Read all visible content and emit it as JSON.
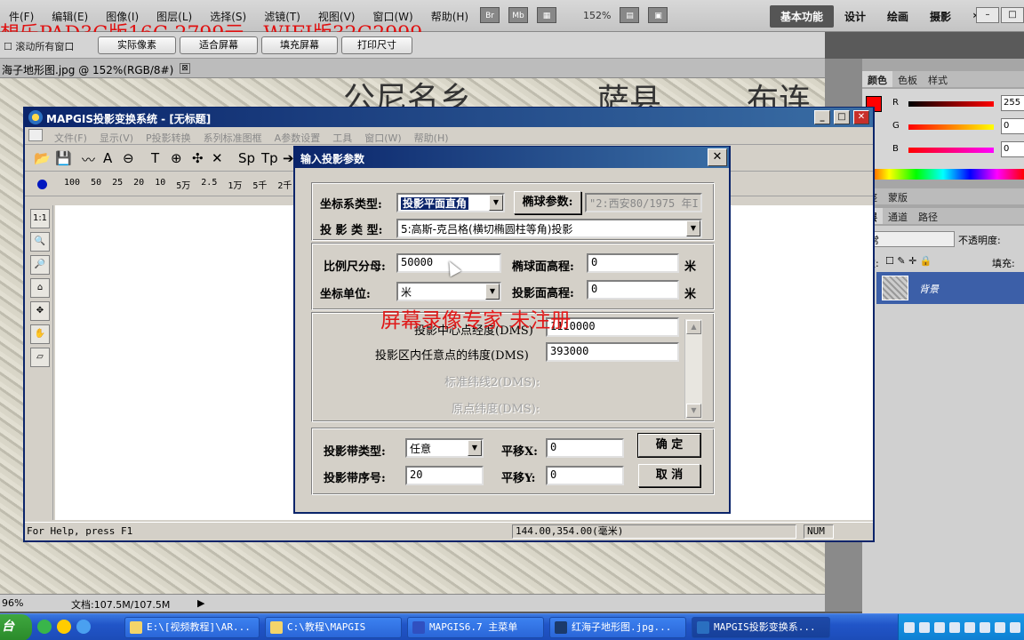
{
  "ps": {
    "menus": [
      "件(F)",
      "编辑(E)",
      "图像(I)",
      "图层(L)",
      "选择(S)",
      "滤镜(T)",
      "视图(V)",
      "窗口(W)",
      "帮助(H)"
    ],
    "br": "Br",
    "mb": "Mb",
    "zoom": "152%",
    "workspaces": [
      "基本功能",
      "设计",
      "绘画",
      "摄影",
      "»"
    ],
    "promo": "想乐PAD3G版16G 2799元，WIFI版32G2999",
    "scroll_all": "滚动所有窗口",
    "options": [
      "实际像素",
      "适合屏幕",
      "填充屏幕",
      "打印尺寸"
    ],
    "doc_tab": "海子地形图.jpg @ 152%(RGB/8#)",
    "doc_tab_close": "⊠",
    "canvas_text": [
      "公尼名乡",
      "萨县",
      "布连"
    ],
    "status_zoom": "96%",
    "status_doc": "文档:107.5M/107.5M",
    "color_tabs": [
      "颜色",
      "色板",
      "样式"
    ],
    "rgb": [
      {
        "label": "R",
        "value": "255"
      },
      {
        "label": "G",
        "value": "0"
      },
      {
        "label": "B",
        "value": "0"
      }
    ],
    "layer_tabs": [
      "整",
      "蒙版"
    ],
    "layer_tabs2": [
      "层",
      "通道",
      "路径"
    ],
    "blend_mode": "常",
    "opacity_label": "不透明度:",
    "lock_label": "定:",
    "fill_label": "填充:",
    "layer_name": "背景",
    "colors": {
      "accent_red": "#ff0000",
      "titlebar": "#0a246a"
    }
  },
  "mapgis": {
    "title": "MAPGIS投影变换系统 - [无标题]",
    "menus": [
      "文件(F)",
      "显示(V)",
      "P投影转换",
      "系列标准图框",
      "A参数设置",
      "工具",
      "窗口(W)",
      "帮助(H)"
    ],
    "toolbar_text": [
      "T",
      "Sp",
      "Tp"
    ],
    "scales": [
      "100",
      "50",
      "25",
      "20",
      "10",
      "5万",
      "2.5",
      "1万",
      "5千",
      "2千"
    ],
    "left_tool": "1:1",
    "status_help": "For Help, press F1",
    "status_coords": "144.00,354.00(毫米)",
    "status_num": "NUM"
  },
  "dialog": {
    "title": "输入投影参数",
    "close": "✕",
    "coord_type_label": "坐标系类型:",
    "coord_type_value": "投影平面直角",
    "ellipsoid_label": "椭球参数:",
    "ellipsoid_value": "\"2:西安80/1975 年I",
    "proj_type_label": "投 影 类 型:",
    "proj_type_value": "5:高斯-克吕格(横切椭圆柱等角)投影",
    "scale_label": "比例尺分母:",
    "scale_value": "50000",
    "ellip_height_label": "椭球面高程:",
    "ellip_height_value": "0",
    "ellip_height_unit": "米",
    "unit_label": "坐标单位:",
    "unit_value": "米",
    "proj_height_label": "投影面高程:",
    "proj_height_value": "0",
    "proj_height_unit": "米",
    "center_lon_label": "投影中心点经度(DMS)",
    "center_lon_value": "1110000",
    "lat_label": "投影区内任意点的纬度(DMS)",
    "lat_value": "393000",
    "std_lat2_label": "标准纬线2(DMS):",
    "origin_lat_label": "原点纬度(DMS):",
    "zone_type_label": "投影带类型:",
    "zone_type_value": "任意",
    "shift_x_label": "平移X:",
    "shift_x_value": "0",
    "zone_no_label": "投影带序号:",
    "zone_no_value": "20",
    "shift_y_label": "平移Y:",
    "shift_y_value": "0",
    "ok": "确 定",
    "cancel": "取 消",
    "watermark": "屏幕录像专家  未注册",
    "scroll_up": "▲",
    "scroll_down": "▼"
  },
  "taskbar": {
    "start": "台",
    "tasks": [
      "E:\\[视频教程]\\AR...",
      "C:\\教程\\MAPGIS",
      "MAPGIS6.7 主菜单",
      "红海子地形图.jpg...",
      "MAPGIS投影变换系..."
    ]
  }
}
